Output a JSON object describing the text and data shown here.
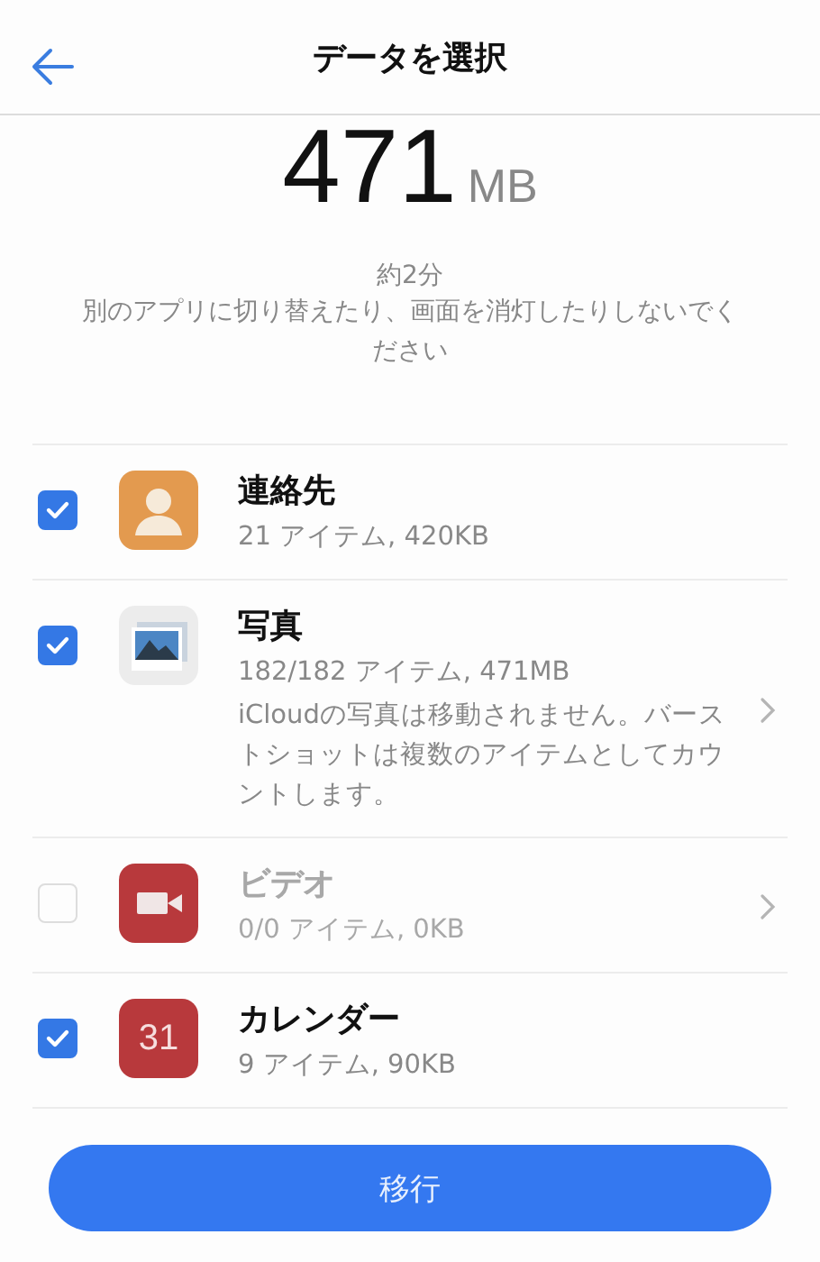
{
  "header": {
    "title": "データを選択"
  },
  "summary": {
    "size": "471",
    "unit": "MB",
    "time": "約2分",
    "notice": "別のアプリに切り替えたり、画面を消灯したりしないでください"
  },
  "items": [
    {
      "kind": "contacts",
      "name": "連絡先",
      "detail": "21 アイテム, 420KB",
      "checked": true,
      "disabled": false,
      "chevron": false
    },
    {
      "kind": "photos",
      "name": "写真",
      "detail": "182/182 アイテム, 471MB",
      "note": "iCloudの写真は移動されません。バーストショットは複数のアイテムとしてカウントします。",
      "checked": true,
      "disabled": false,
      "chevron": true
    },
    {
      "kind": "video",
      "name": "ビデオ",
      "detail": "0/0 アイテム, 0KB",
      "checked": false,
      "disabled": true,
      "chevron": true
    },
    {
      "kind": "calendar",
      "name": "カレンダー",
      "detail": "9 アイテム, 90KB",
      "icon_text": "31",
      "checked": true,
      "disabled": false,
      "chevron": false
    }
  ],
  "button": "移行"
}
